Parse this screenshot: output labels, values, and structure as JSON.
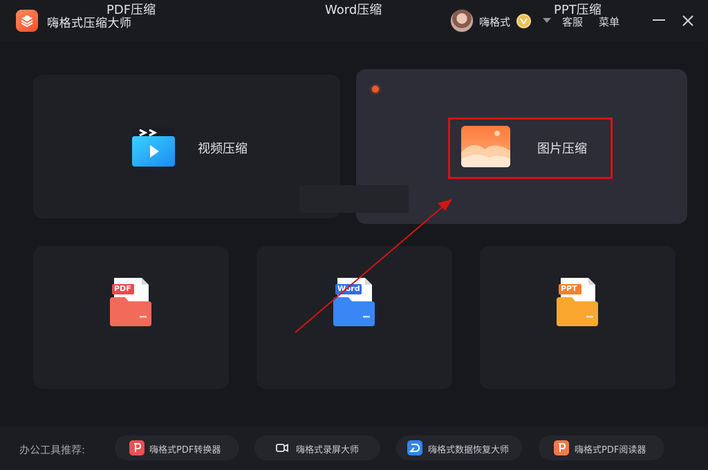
{
  "app": {
    "title": "嗨格式压缩大师"
  },
  "header": {
    "user_name": "嗨格式",
    "service_label": "客服",
    "menu_label": "菜单"
  },
  "cards": {
    "video": {
      "label": "视频压缩",
      "icon": "video-clapper-icon"
    },
    "image": {
      "label": "图片压缩",
      "icon": "image-landscape-icon",
      "selected": true
    },
    "pdf": {
      "label": "PDF压缩",
      "badge": "PDF",
      "icon": "pdf-folder-icon"
    },
    "word": {
      "label": "Word压缩",
      "badge": "Word",
      "icon": "word-folder-icon"
    },
    "ppt": {
      "label": "PPT压缩",
      "badge": "PPT",
      "icon": "ppt-folder-icon"
    }
  },
  "footer": {
    "label": "办公工具推荐:",
    "tools": [
      {
        "label": "嗨格式PDF转换器",
        "icon": "pdf-converter-icon"
      },
      {
        "label": "嗨格式录屏大师",
        "icon": "screen-recorder-icon"
      },
      {
        "label": "嗨格式数据恢复大师",
        "icon": "data-recovery-icon"
      },
      {
        "label": "嗨格式PDF阅读器",
        "icon": "pdf-reader-icon"
      }
    ]
  },
  "colors": {
    "accent": "#f4512c",
    "annotation_red": "#d31414",
    "background": "#17181c"
  }
}
